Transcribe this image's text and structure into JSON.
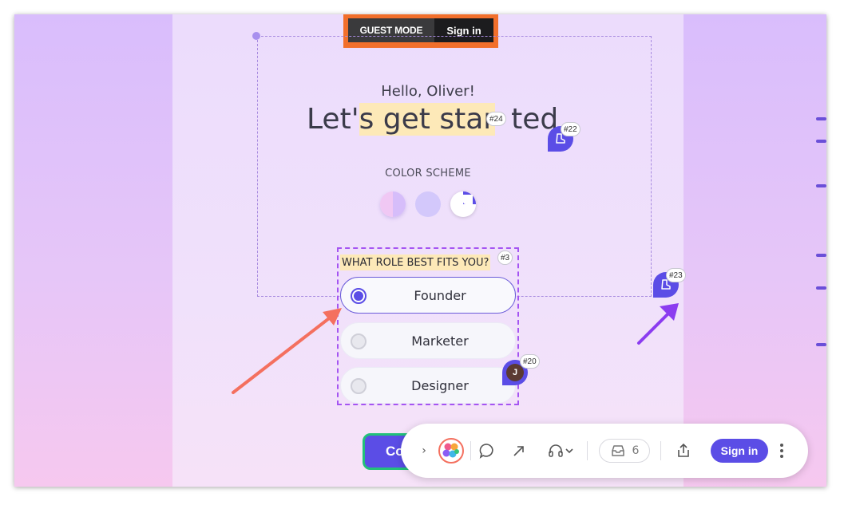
{
  "guest_bar": {
    "mode_label": "GUEST MODE",
    "signin_label": "Sign in"
  },
  "welcome": {
    "greeting": "Hello, Oliver!",
    "headline_pre": "Let'",
    "headline_highlight": "s get star",
    "headline_post": "ted",
    "headline_tag": "#24"
  },
  "color_scheme": {
    "label": "COLOR SCHEME",
    "options": [
      "split-light",
      "lavender",
      "dark-quarter"
    ]
  },
  "role": {
    "question": "WHAT ROLE BEST FITS YOU?",
    "question_tag": "#3",
    "options": [
      {
        "label": "Founder",
        "selected": true
      },
      {
        "label": "Marketer",
        "selected": false
      },
      {
        "label": "Designer",
        "selected": false
      }
    ]
  },
  "comment_pins": [
    {
      "tag": "#22",
      "icon": "boot-icon"
    },
    {
      "tag": "#23",
      "icon": "boot-icon"
    },
    {
      "tag": "#20",
      "avatar_initial": "J"
    }
  ],
  "continue_button": {
    "label_visible": "Co"
  },
  "toolbar": {
    "inbox_count": "6",
    "signin_label": "Sign in"
  },
  "colors": {
    "accent": "#5b4de6",
    "guest_border": "#f26f2b",
    "highlight": "#fde9b8",
    "arrow_salmon": "#f4705f",
    "arrow_purple": "#8b3cf0",
    "continue_border": "#22c07a"
  }
}
